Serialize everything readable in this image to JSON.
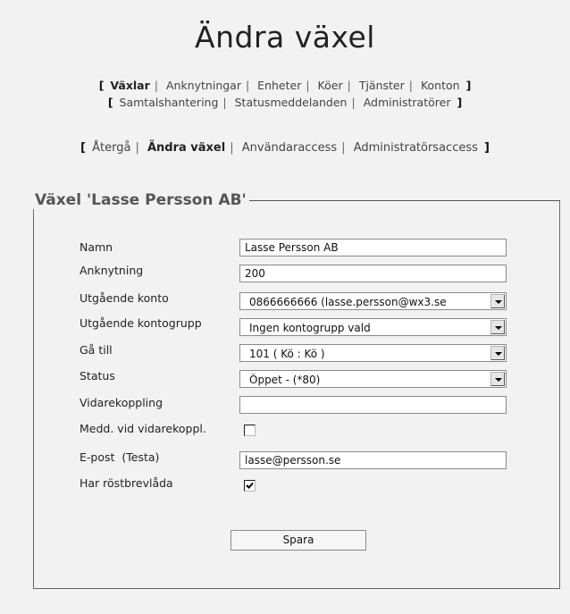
{
  "page": {
    "title": "Ändra växel"
  },
  "nav_primary": {
    "row1": [
      "Växlar",
      "Anknytningar",
      "Enheter",
      "Köer",
      "Tjänster",
      "Konton"
    ],
    "row2": [
      "Samtalshantering",
      "Statusmeddelanden",
      "Administratörer"
    ]
  },
  "nav_secondary": [
    "Återgå",
    "Ändra växel",
    "Användaraccess",
    "Administratörsaccess"
  ],
  "form": {
    "legend": "Växel 'Lasse Persson AB'",
    "namn_label": "Namn",
    "namn_value": "Lasse Persson AB",
    "anknytning_label": "Anknytning",
    "anknytning_value": "200",
    "utg_konto_label": "Utgående konto",
    "utg_konto_value": "0866666666 (lasse.persson@wx3.se",
    "utg_kontogrupp_label": "Utgående kontogrupp",
    "utg_kontogrupp_value": "Ingen kontogrupp vald",
    "ga_till_label": "Gå till",
    "ga_till_value": "101 ( Kö : Kö )",
    "status_label": "Status",
    "status_value": "Öppet - (*80)",
    "vidarekoppling_label": "Vidarekoppling",
    "vidarekoppling_value": "",
    "medd_label": "Medd. vid vidarekoppl.",
    "medd_checked": false,
    "epost_label": "E-post",
    "testa_label": "(Testa)",
    "epost_value": "lasse@persson.se",
    "rostbrevlada_label": "Har röstbrevlåda",
    "rostbrevlada_checked": true,
    "save_label": "Spara"
  }
}
